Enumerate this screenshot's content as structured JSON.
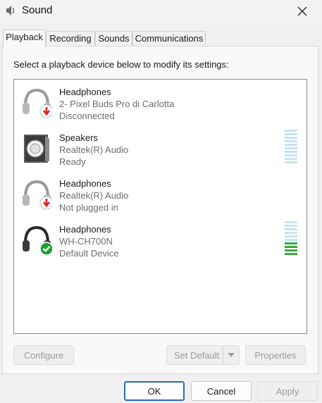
{
  "window": {
    "title": "Sound"
  },
  "tabs": [
    {
      "label": "Playback",
      "active": true
    },
    {
      "label": "Recording",
      "active": false
    },
    {
      "label": "Sounds",
      "active": false
    },
    {
      "label": "Communications",
      "active": false
    }
  ],
  "prompt": "Select a playback device below to modify its settings:",
  "devices": [
    {
      "name": "Headphones",
      "description": "2- Pixel Buds Pro di Carlotta",
      "status": "Disconnected",
      "icon": "headphones-disconnected-icon",
      "badge": "red-down-arrow",
      "meter_level": null
    },
    {
      "name": "Speakers",
      "description": "Realtek(R) Audio",
      "status": "Ready",
      "icon": "speakers-icon",
      "badge": null,
      "meter_level": 0
    },
    {
      "name": "Headphones",
      "description": "Realtek(R) Audio",
      "status": "Not plugged in",
      "icon": "headphones-unplugged-icon",
      "badge": "red-down-arrow",
      "meter_level": null
    },
    {
      "name": "Headphones",
      "description": "WH-CH700N",
      "status": "Default Device",
      "icon": "headphones-default-icon",
      "badge": "green-check",
      "meter_level": 0.4
    }
  ],
  "panel_buttons": {
    "configure": "Configure",
    "set_default": "Set Default",
    "properties": "Properties"
  },
  "dialog_buttons": {
    "ok": "OK",
    "cancel": "Cancel",
    "apply": "Apply"
  },
  "colors": {
    "accent": "#2a67c4",
    "meter_idle": "#c6e3f1",
    "meter_active": "#3aaa40",
    "badge_red": "#d42020",
    "badge_green": "#1e9e34"
  }
}
